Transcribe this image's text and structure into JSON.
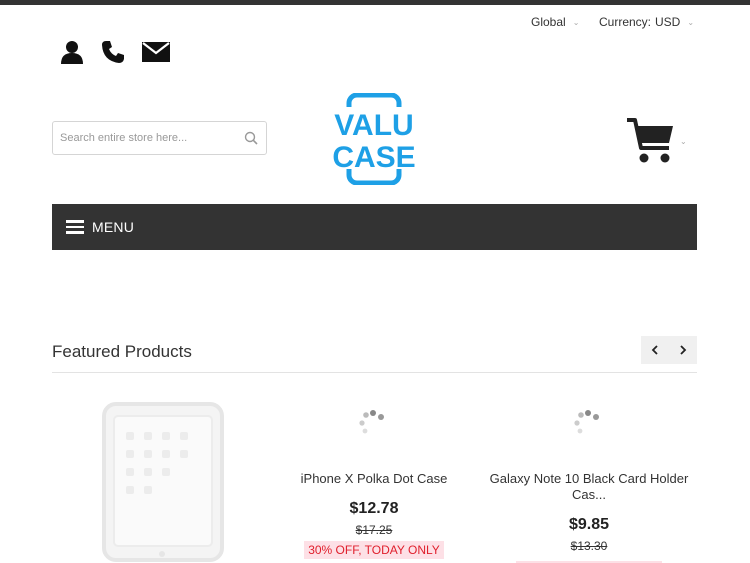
{
  "header": {
    "region_label": "Global",
    "currency_label": "Currency:",
    "currency_value": "USD",
    "icons": [
      "account-icon",
      "phone-icon",
      "email-icon",
      "cart-icon"
    ]
  },
  "search": {
    "placeholder": "Search entire store here..."
  },
  "logo": {
    "line1": "VALU",
    "line2": "CASE",
    "color": "#1ea0e6"
  },
  "menu": {
    "label": "MENU"
  },
  "featured": {
    "title": "Featured Products",
    "products": [
      {
        "name": "",
        "image": "ipad-case-image"
      },
      {
        "name": "iPhone X Polka Dot Case",
        "price": "$12.78",
        "old_price": "$17.25",
        "badge": "30% OFF, TODAY ONLY"
      },
      {
        "name": "Galaxy Note 10 Black Card Holder Cas...",
        "price": "$9.85",
        "old_price": "$13.30",
        "badge": ""
      }
    ]
  },
  "colors": {
    "menu_bg": "#333333",
    "badge_bg": "#fde0e6",
    "badge_text": "#e0202d",
    "brand_blue": "#1ea0e6"
  }
}
